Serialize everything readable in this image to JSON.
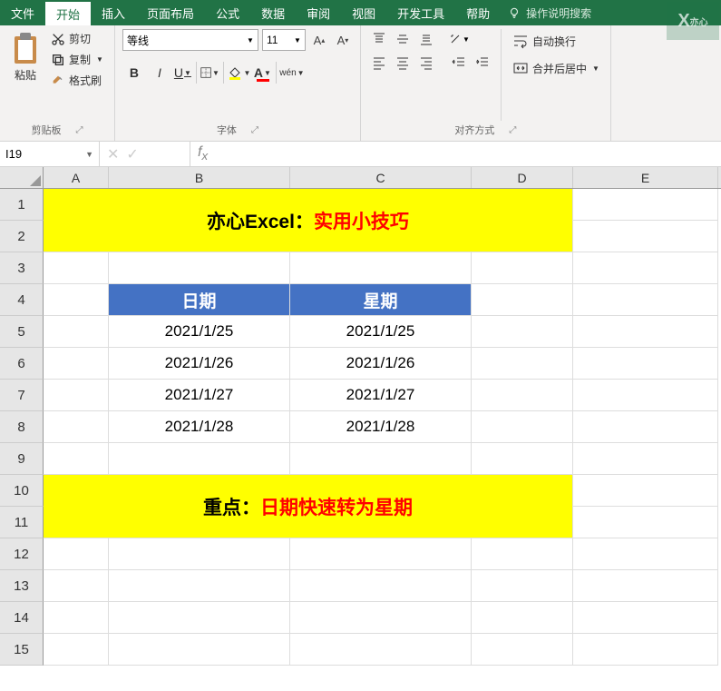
{
  "ribbon": {
    "tabs": [
      "文件",
      "开始",
      "插入",
      "页面布局",
      "公式",
      "数据",
      "审阅",
      "视图",
      "开发工具",
      "帮助"
    ],
    "active_tab": "开始",
    "tellme": "操作说明搜索",
    "clipboard": {
      "paste": "粘贴",
      "cut": "剪切",
      "copy": "复制",
      "format_painter": "格式刷",
      "label": "剪贴板"
    },
    "font": {
      "name": "等线",
      "size": "11",
      "label": "字体",
      "wen": "wén"
    },
    "alignment": {
      "wrap": "自动换行",
      "merge": "合并后居中",
      "label": "对齐方式"
    }
  },
  "namebox": {
    "ref": "I19",
    "formula": ""
  },
  "grid": {
    "cols": [
      "A",
      "B",
      "C",
      "D",
      "E"
    ],
    "rows": [
      "1",
      "2",
      "3",
      "4",
      "5",
      "6",
      "7",
      "8",
      "9",
      "10",
      "11",
      "12",
      "13",
      "14",
      "15"
    ],
    "title": {
      "black": "亦心Excel：",
      "red": "实用小技巧"
    },
    "headers": {
      "date": "日期",
      "week": "星期"
    },
    "data": [
      {
        "b": "2021/1/25",
        "c": "2021/1/25"
      },
      {
        "b": "2021/1/26",
        "c": "2021/1/26"
      },
      {
        "b": "2021/1/27",
        "c": "2021/1/27"
      },
      {
        "b": "2021/1/28",
        "c": "2021/1/28"
      }
    ],
    "footer": {
      "black": "重点：",
      "red": "日期快速转为星期"
    }
  }
}
